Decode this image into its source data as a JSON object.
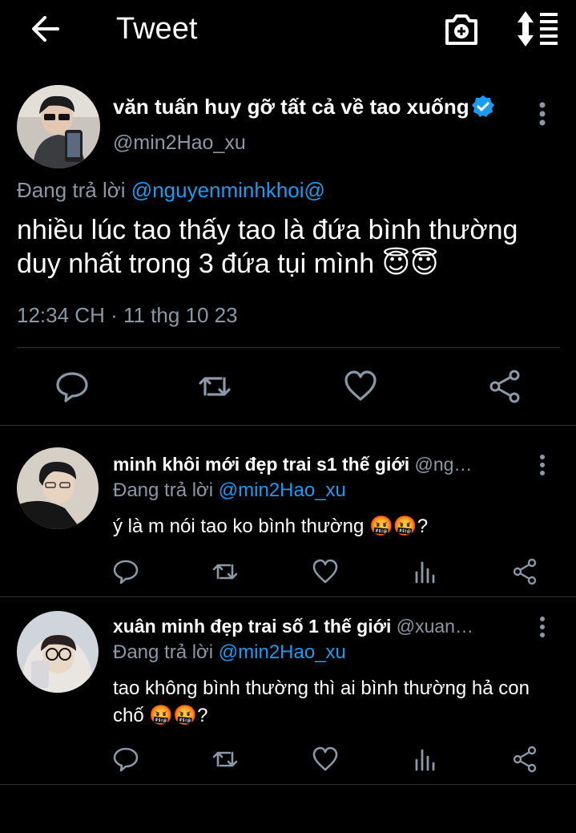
{
  "header": {
    "title": "Tweet",
    "back_icon": "arrow-left-icon",
    "camera_icon": "camera-plus-icon",
    "sort_icon": "sort-lines-icon"
  },
  "main_tweet": {
    "author_name": "văn tuấn huy gỡ tất cả về tao xuống",
    "handle": "@min2Hao_xu",
    "reply_prefix": "Đang trả lời",
    "reply_to": "@nguyenminhkhoi@",
    "text": "nhiều lúc tao thấy tao là đứa bình thường duy nhất trong 3 đứa tụi mình 😇😇",
    "time": "12:34 CH · 11 thg 10 23"
  },
  "replies": [
    {
      "author_name": "minh khôi mới đẹp trai s1 thế giới",
      "handle": "@ng…",
      "reply_prefix": "Đang trả lời",
      "reply_to": "@min2Hao_xu",
      "text": "ý là m nói tao ko bình thường 🤬🤬?"
    },
    {
      "author_name": "xuân minh đẹp trai số 1 thế giới",
      "handle": "@xuan…",
      "reply_prefix": "Đang trả lời",
      "reply_to": "@min2Hao_xu",
      "text": "tao không bình thường thì ai bình thường hả con chố 🤬🤬?"
    }
  ],
  "colors": {
    "background": "#000000",
    "accent": "#1d9bf0",
    "muted": "#8b98a5",
    "divider": "#2f3336"
  }
}
